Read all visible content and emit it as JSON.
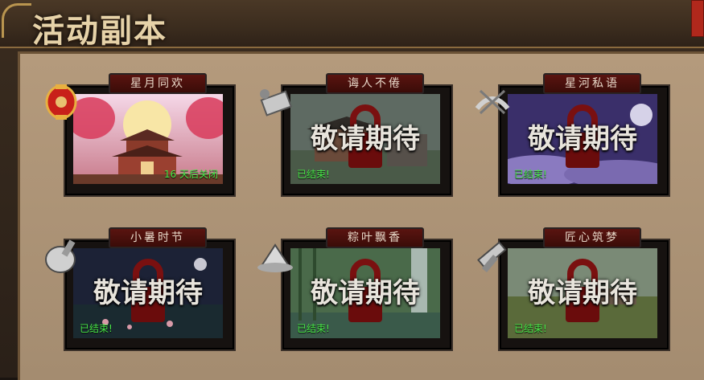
{
  "window": {
    "title": "活动副本"
  },
  "cards": [
    {
      "title": "星月同欢",
      "status": "16 天后关闭",
      "overlay": "",
      "badge": "lantern-icon"
    },
    {
      "title": "诲人不倦",
      "status": "已结束!",
      "overlay": "敬请期待",
      "badge": "scroll-icon"
    },
    {
      "title": "星河私语",
      "status": "已结束!",
      "overlay": "敬请期待",
      "badge": "magpie-bridge-icon"
    },
    {
      "title": "小暑时节",
      "status": "已结束!",
      "overlay": "敬请期待",
      "badge": "bell-charm-icon"
    },
    {
      "title": "粽叶飘香",
      "status": "已结束!",
      "overlay": "敬请期待",
      "badge": "zongzi-icon"
    },
    {
      "title": "匠心筑梦",
      "status": "已结束!",
      "overlay": "敬请期待",
      "badge": "hammer-icon"
    }
  ],
  "colors": {
    "status_green": "#48e848",
    "title_banner": "#5a1410",
    "panel": "#b49a7c"
  }
}
